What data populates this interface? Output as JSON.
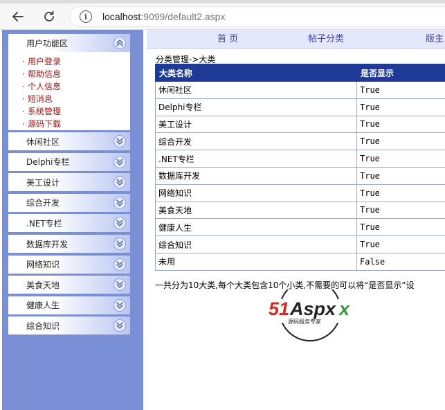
{
  "browser": {
    "url_host": "localhost",
    "url_rest": ":9099/default2.aspx"
  },
  "leftnav": {
    "user_panel": {
      "title": "用户功能区",
      "items": [
        "用户登录",
        "帮助信息",
        "个人信息",
        "短消息",
        "系统管理",
        "源码下载"
      ]
    },
    "categories": [
      "休闲社区",
      "Delphi专栏",
      "美工设计",
      "综合开发",
      ".NET专栏",
      "数据库开发",
      "网络知识",
      "美食天地",
      "健康人生",
      "综合知识"
    ]
  },
  "topmenu": {
    "items": [
      "首  页",
      "帖子分类",
      "版主"
    ]
  },
  "content": {
    "breadcrumb": "分类管理->大类",
    "table": {
      "headers": [
        "大类名称",
        "是否显示"
      ],
      "rows": [
        [
          "休闲社区",
          "True"
        ],
        [
          "Delphi专栏",
          "True"
        ],
        [
          "美工设计",
          "True"
        ],
        [
          "综合开发",
          "True"
        ],
        [
          ".NET专栏",
          "True"
        ],
        [
          "数据库开发",
          "True"
        ],
        [
          "网络知识",
          "True"
        ],
        [
          "美食天地",
          "True"
        ],
        [
          "健康人生",
          "True"
        ],
        [
          "综合知识",
          "True"
        ],
        [
          "未用",
          "False"
        ]
      ]
    },
    "note": "一共分为10大类,每个大类包含10个小类,不需要的可以将“是否显示”设",
    "logo": {
      "text": "51Aspx",
      "subtitle": "源码服务专家",
      "colors": {
        "red": "#d42a1f",
        "green": "#2f9a3a",
        "dark": "#222222"
      }
    }
  }
}
